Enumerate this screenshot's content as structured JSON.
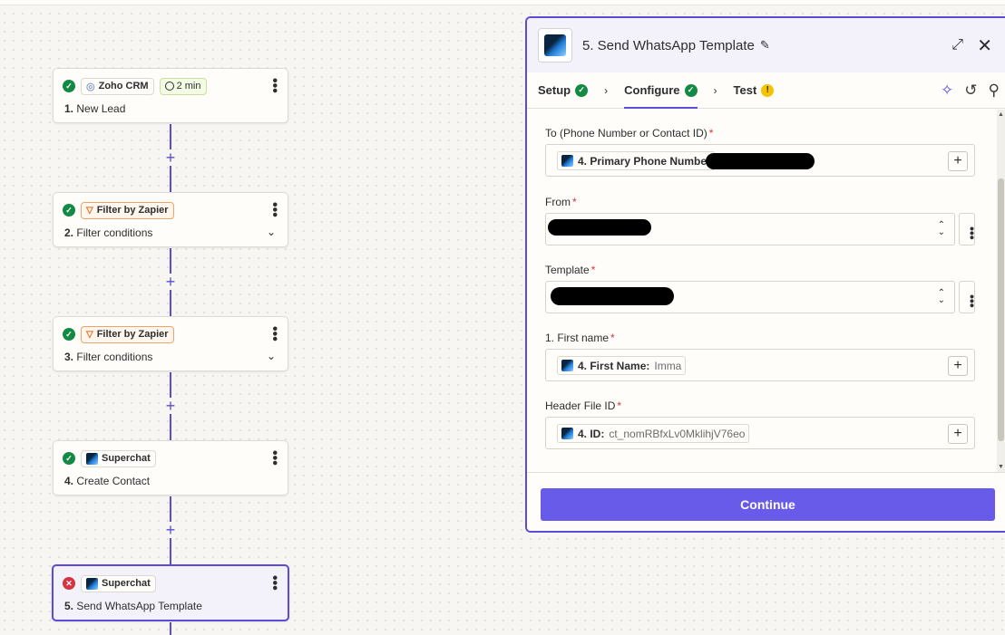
{
  "steps": [
    {
      "status": "ok",
      "app": "Zoho CRM",
      "duration": "2 min",
      "number": "1.",
      "title": "New Lead"
    },
    {
      "status": "ok",
      "app": "Filter by Zapier",
      "number": "2.",
      "title": "Filter conditions"
    },
    {
      "status": "ok",
      "app": "Filter by Zapier",
      "number": "3.",
      "title": "Filter conditions"
    },
    {
      "status": "ok",
      "app": "Superchat",
      "number": "4.",
      "title": "Create Contact"
    },
    {
      "status": "error",
      "app": "Superchat",
      "number": "5.",
      "title": "Send WhatsApp Template"
    }
  ],
  "panel": {
    "title": "5. Send WhatsApp Template",
    "tabs": [
      {
        "label": "Setup",
        "state": "complete"
      },
      {
        "label": "Configure",
        "state": "complete",
        "active": true
      },
      {
        "label": "Test",
        "state": "warning"
      }
    ],
    "fields": {
      "to": {
        "label": "To (Phone Number or Contact ID)",
        "token_label": "4. Primary Phone Number",
        "token_value": ""
      },
      "from": {
        "label": "From"
      },
      "template": {
        "label": "Template"
      },
      "first_name": {
        "label": "1. First name",
        "token_label": "4. First Name:",
        "token_value": "Imma"
      },
      "header_file": {
        "label": "Header File ID",
        "token_label": "4. ID:",
        "token_value": "ct_nomRBfxLv0MklihjV76eo"
      }
    },
    "required_marker": "*",
    "continue_label": "Continue"
  },
  "colors": {
    "accent": "#5b4bd6",
    "button": "#695be9",
    "success": "#138a44",
    "error": "#d6333f",
    "warning": "#f5c400",
    "filter": "#e26b1c"
  }
}
